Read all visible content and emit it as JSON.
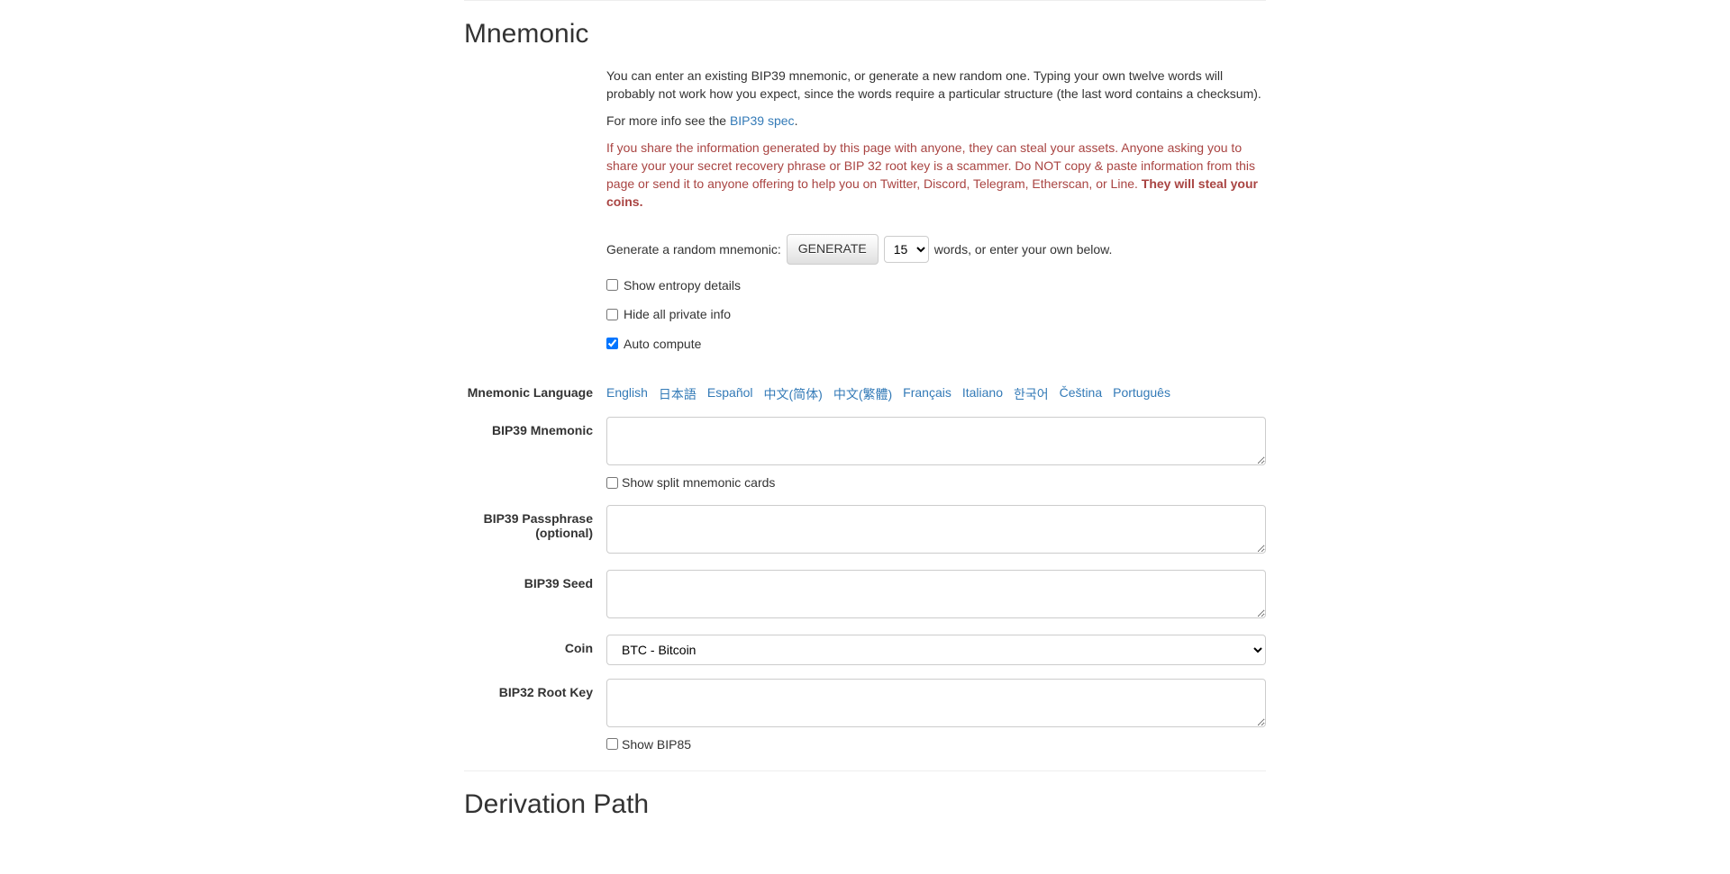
{
  "mnemonic": {
    "heading": "Mnemonic",
    "intro_text": "You can enter an existing BIP39 mnemonic, or generate a new random one. Typing your own twelve words will probably not work how you expect, since the words require a particular structure (the last word contains a checksum).",
    "more_info_prefix": "For more info see the ",
    "more_info_link": "BIP39 spec",
    "more_info_suffix": ".",
    "warning_text": "If you share the information generated by this page with anyone, they can steal your assets. Anyone asking you to share your your secret recovery phrase or BIP 32 root key is a scammer. Do NOT copy & paste information from this page or send it to anyone offering to help you on Twitter, Discord, Telegram, Etherscan, or Line. ",
    "warning_strong": "They will steal your coins.",
    "generate_prefix": "Generate a random mnemonic:",
    "generate_button": "GENERATE",
    "word_count": "15",
    "generate_suffix": "words, or enter your own below.",
    "show_entropy_label": "Show entropy details",
    "hide_private_label": "Hide all private info",
    "auto_compute_label": "Auto compute",
    "language_label": "Mnemonic Language",
    "languages": [
      "English",
      "日本語",
      "Español",
      "中文(简体)",
      "中文(繁體)",
      "Français",
      "Italiano",
      "한국어",
      "Čeština",
      "Português"
    ],
    "bip39_mnemonic_label": "BIP39 Mnemonic",
    "show_split_cards_label": "Show split mnemonic cards",
    "passphrase_label": "BIP39 Passphrase (optional)",
    "seed_label": "BIP39 Seed",
    "coin_label": "Coin",
    "coin_value": "BTC - Bitcoin",
    "root_key_label": "BIP32 Root Key",
    "show_bip85_label": "Show BIP85"
  },
  "derivation": {
    "heading": "Derivation Path"
  }
}
